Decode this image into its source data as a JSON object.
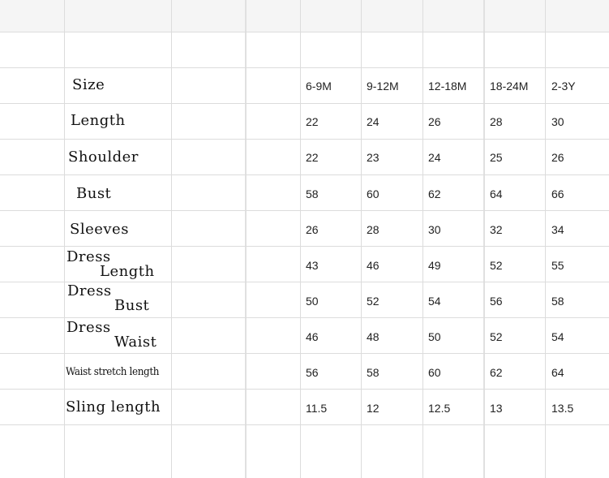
{
  "table": {
    "size_label": "Size",
    "sizes": [
      "6-9M",
      "9-12M",
      "12-18M",
      "18-24M",
      "2-3Y"
    ],
    "rows": [
      {
        "label_lines": [
          "Length"
        ],
        "values": [
          "22",
          "24",
          "26",
          "28",
          "30"
        ]
      },
      {
        "label_lines": [
          "Shoulder"
        ],
        "values": [
          "22",
          "23",
          "24",
          "25",
          "26"
        ]
      },
      {
        "label_lines": [
          "Bust"
        ],
        "values": [
          "58",
          "60",
          "62",
          "64",
          "66"
        ]
      },
      {
        "label_lines": [
          "Sleeves"
        ],
        "values": [
          "26",
          "28",
          "30",
          "32",
          "34"
        ]
      },
      {
        "label_lines": [
          "Dress",
          "Length"
        ],
        "values": [
          "43",
          "46",
          "49",
          "52",
          "55"
        ]
      },
      {
        "label_lines": [
          "Dress",
          "Bust"
        ],
        "values": [
          "50",
          "52",
          "54",
          "56",
          "58"
        ]
      },
      {
        "label_lines": [
          "Dress",
          "Waist"
        ],
        "values": [
          "46",
          "48",
          "50",
          "52",
          "54"
        ]
      },
      {
        "label_lines": [
          "Waist stretch length"
        ],
        "values": [
          "56",
          "58",
          "60",
          "62",
          "64"
        ]
      },
      {
        "label_lines": [
          "Sling length"
        ],
        "values": [
          "11.5",
          "12",
          "12.5",
          "13",
          "13.5"
        ]
      }
    ]
  }
}
